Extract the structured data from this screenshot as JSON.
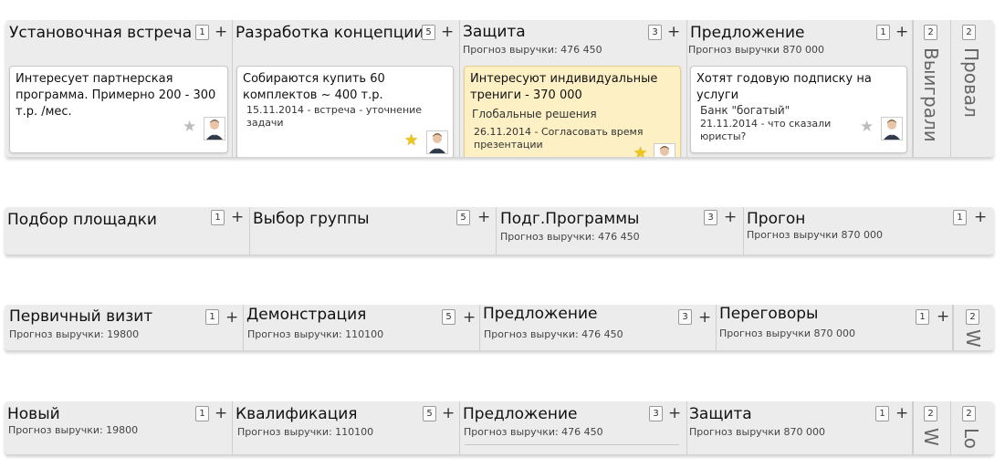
{
  "board1": {
    "stages": [
      {
        "title": "Установочная встреча",
        "count": "1",
        "plus": "+"
      },
      {
        "title": "Разработка концепции",
        "count": "5",
        "plus": "+"
      },
      {
        "title": "Защита",
        "count": "3",
        "plus": "+",
        "forecast": "Прогноз выручки: 476 450"
      },
      {
        "title": "Предложение",
        "count": "1",
        "plus": "+",
        "forecast": "Прогноз выручки 870 000"
      }
    ],
    "won": {
      "title": "Выиграли",
      "count": "2"
    },
    "lost": {
      "title": "Провал",
      "count": "2"
    },
    "cards": {
      "c1": {
        "text": "Интересует партнерская программа. Примерно 200 - 300 т.р. /мес."
      },
      "c2": {
        "text": "Собираются купить 60 комплектов ~ 400 т.р.",
        "meta": "15.11.2014 - встреча - уточнение задачи"
      },
      "c3": {
        "text": "Интересуют индивидуальные трениги - 370 000",
        "company": "Глобальные решения",
        "meta": "26.11.2014 - Согласовать время презентации"
      },
      "c4": {
        "text": "Хотят годовую подписку на услуги",
        "company": "Банк \"богатый\"",
        "meta": "21.11.2014 - что сказали юристы?"
      }
    }
  },
  "board2": {
    "stages": [
      {
        "title": "Подбор площадки",
        "count": "1",
        "plus": "+"
      },
      {
        "title": "Выбор группы",
        "count": "5",
        "plus": "+"
      },
      {
        "title": "Подг.Программы",
        "count": "3",
        "plus": "+",
        "forecast": "Прогноз выручки: 476 450"
      },
      {
        "title": "Прогон",
        "count": "1",
        "plus": "+",
        "forecast": "Прогноз выручки 870 000"
      }
    ]
  },
  "board3": {
    "stages": [
      {
        "title": "Первичный визит",
        "count": "1",
        "plus": "+",
        "forecast": "Прогноз выручки:  19800"
      },
      {
        "title": "Демонстрация",
        "count": "5",
        "plus": "+",
        "forecast": "Прогноз выручки:  110100"
      },
      {
        "title": "Предложение",
        "count": "3",
        "plus": "+",
        "forecast": "Прогноз выручки: 476 450"
      },
      {
        "title": "Переговоры",
        "count": "1",
        "plus": "+",
        "forecast": "Прогноз выручки 870 000"
      }
    ],
    "won": {
      "title": "W",
      "count": "2"
    }
  },
  "board4": {
    "stages": [
      {
        "title": "Новый",
        "count": "1",
        "plus": "+",
        "forecast": "Прогноз выручки:  19800"
      },
      {
        "title": "Квалификация",
        "count": "5",
        "plus": "+",
        "forecast": "Прогноз выручки:  110100"
      },
      {
        "title": "Предложение",
        "count": "3",
        "plus": "+",
        "forecast": "Прогноз выручки: 476 450"
      },
      {
        "title": "Защита",
        "count": "1",
        "plus": "+",
        "forecast": "Прогноз выручки 870 000"
      }
    ],
    "won": {
      "title": "W",
      "count": "2"
    },
    "lost": {
      "title": "Lo",
      "count": "2"
    }
  },
  "icons": {
    "star": "star-icon",
    "avatar": "user-avatar-icon"
  },
  "colors": {
    "board_bg": "#ececec",
    "highlight_card": "#fdf0c4",
    "star_gold": "#f0c419"
  }
}
